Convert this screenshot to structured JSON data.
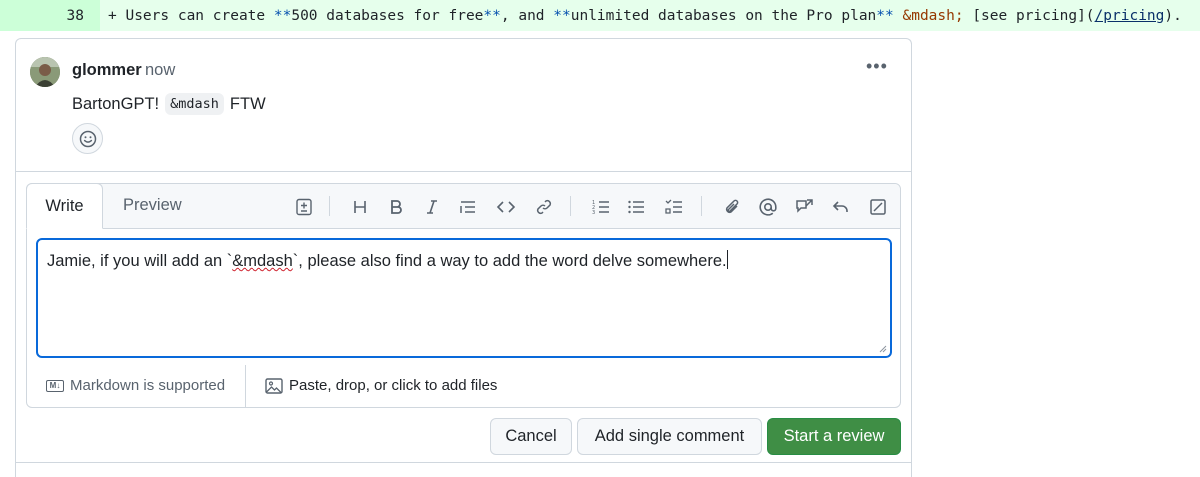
{
  "diff": {
    "line_number": "38",
    "segments": [
      {
        "t": "+ Users can create ",
        "c": "tok-punct"
      },
      {
        "t": "**",
        "c": "tok-bold"
      },
      {
        "t": "500 databases for free",
        "c": "tok-punct"
      },
      {
        "t": "**",
        "c": "tok-bold"
      },
      {
        "t": ", and ",
        "c": "tok-punct"
      },
      {
        "t": "**",
        "c": "tok-bold"
      },
      {
        "t": "unlimited databases on the Pro plan",
        "c": "tok-punct"
      },
      {
        "t": "**",
        "c": "tok-bold"
      },
      {
        "t": " ",
        "c": "tok-punct"
      },
      {
        "t": "&mdash;",
        "c": "tok-entity"
      },
      {
        "t": " [see pricing](",
        "c": "tok-punct"
      },
      {
        "t": "/pricing",
        "c": "tok-link"
      },
      {
        "t": ").",
        "c": "tok-punct"
      }
    ]
  },
  "comment": {
    "author": "glommer",
    "timestamp": "now",
    "body_before": "BartonGPT!",
    "body_code": "&mdash",
    "body_after": "FTW",
    "kebab": "•••"
  },
  "editor": {
    "tab_write": "Write",
    "tab_preview": "Preview",
    "text_before": "Jamie, if you will add an `",
    "text_spell": "&mdash",
    "text_after": "`, please also find a way to add the word delve somewhere.",
    "markdown_label": "Markdown is supported",
    "attach_label": "Paste, drop, or click to add files",
    "toolbar_icons": [
      "insert-suggestion-icon",
      "heading-icon",
      "bold-icon",
      "italic-icon",
      "quote-icon",
      "code-icon",
      "link-icon",
      "numbered-list-icon",
      "unordered-list-icon",
      "task-list-icon",
      "attach-icon",
      "mention-icon",
      "cross-reference-icon",
      "reply-icon",
      "fullscreen-icon"
    ]
  },
  "buttons": {
    "cancel": "Cancel",
    "add_single": "Add single comment",
    "start_review": "Start a review"
  },
  "colors": {
    "diff_add_num_bg": "#ccffd8",
    "diff_add_bg": "#e6ffec",
    "focus_border": "#0969da",
    "primary_button": "#3f8e45"
  }
}
